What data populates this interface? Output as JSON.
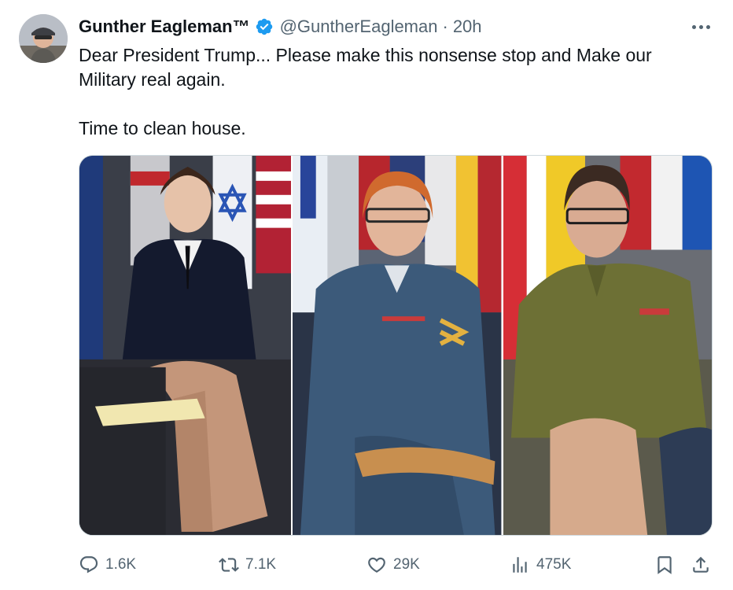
{
  "tweet": {
    "author": {
      "display_name": "Gunther Eagleman™",
      "handle": "@GuntherEagleman",
      "time": "20h",
      "verified": true
    },
    "text_lines": [
      "Dear President Trump... Please make this nonsense stop and Make our Military real again.",
      "Time to clean house."
    ],
    "media": [
      {
        "icon": "photo"
      },
      {
        "icon": "photo"
      },
      {
        "icon": "photo"
      }
    ],
    "actions": {
      "reply_count": "1.6K",
      "repost_count": "7.1K",
      "like_count": "29K",
      "views_count": "475K"
    }
  },
  "icons": {
    "more": "more-icon",
    "verified": "verified-badge-icon",
    "reply": "reply-icon",
    "repost": "repost-icon",
    "like": "like-icon",
    "views": "views-icon",
    "bookmark": "bookmark-icon",
    "share": "share-icon"
  },
  "colors": {
    "text": "#0f1419",
    "secondary": "#536471",
    "verified_blue": "#1d9bf0",
    "border": "#cfd9de"
  }
}
